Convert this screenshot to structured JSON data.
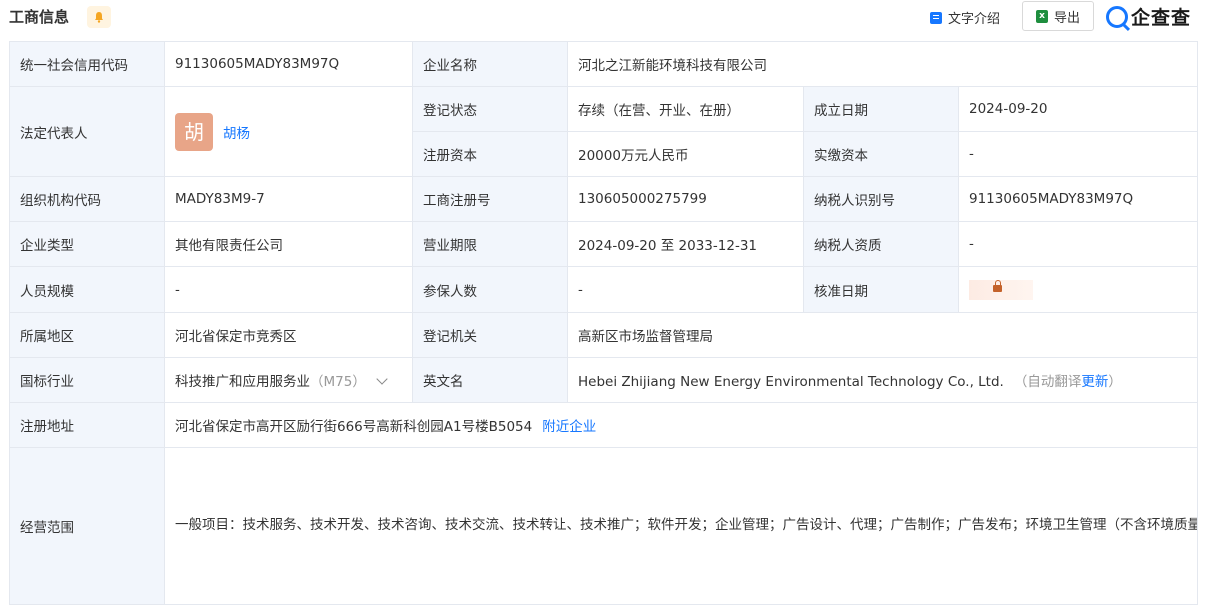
{
  "header": {
    "title": "工商信息",
    "intro_label": "文字介绍",
    "export_label": "导出",
    "logo_text": "企查查"
  },
  "rows": {
    "credit_code": {
      "label": "统一社会信用代码",
      "value": "91130605MADY83M97Q"
    },
    "company_name": {
      "label": "企业名称",
      "value": "河北之江新能环境科技有限公司"
    },
    "legal_rep": {
      "label": "法定代表人",
      "avatar": "胡",
      "name": "胡杨"
    },
    "reg_status": {
      "label": "登记状态",
      "value": "存续（在营、开业、在册）"
    },
    "founded": {
      "label": "成立日期",
      "value": "2024-09-20"
    },
    "reg_capital": {
      "label": "注册资本",
      "value": "20000万元人民币"
    },
    "paid_capital": {
      "label": "实缴资本",
      "value": "-"
    },
    "org_code": {
      "label": "组织机构代码",
      "value": "MADY83M9-7"
    },
    "biz_reg_no": {
      "label": "工商注册号",
      "value": "130605000275799"
    },
    "taxpayer_id": {
      "label": "纳税人识别号",
      "value": "91130605MADY83M97Q"
    },
    "company_type": {
      "label": "企业类型",
      "value": "其他有限责任公司"
    },
    "biz_term": {
      "label": "营业期限",
      "value": "2024-09-20 至 2033-12-31"
    },
    "taxpayer_qual": {
      "label": "纳税人资质",
      "value": "-"
    },
    "staff_size": {
      "label": "人员规模",
      "value": "-"
    },
    "insured": {
      "label": "参保人数",
      "value": "-"
    },
    "approval_date": {
      "label": "核准日期"
    },
    "region": {
      "label": "所属地区",
      "value": "河北省保定市竞秀区"
    },
    "reg_authority": {
      "label": "登记机关",
      "value": "高新区市场监督管理局"
    },
    "industry": {
      "label": "国标行业",
      "value": "科技推广和应用服务业",
      "code": "（M75）"
    },
    "english_name": {
      "label": "英文名",
      "value": "Hebei Zhijiang New Energy Environmental Technology Co., Ltd.",
      "auto_note": "（自动翻译",
      "update_link": "更新",
      "close_paren": "）"
    },
    "reg_address": {
      "label": "注册地址",
      "value": "河北省保定市高开区励行街666号高新科创园A1号楼B5054",
      "nearby_link": "附近企业"
    },
    "scope": {
      "label": "经营范围",
      "value": "一般项目：技术服务、技术开发、技术咨询、技术交流、技术转让、技术推广；软件开发；企业管理；广告设计、代理；广告制作；广告发布；环境卫生管理（不含环境质量监测，污染源检查，城市生活垃圾、建筑垃圾、餐厨垃圾的处置服务）；物业管理；建筑物清洁服务；城市绿化管理；城市公园管理；水污染治理；市政设施管理；园林绿化工程施工；土石方工程施工；租赁服务（不含许可类租赁服务）；特种设备出租；花卉绿植租借与代管理；特种设备销售；机械设备销售；汽车销售；汽车零配件批发；汽车装饰用品销售；礼品花卉销售；金属工具销售；环境保护专用设备销售。（除依法须经批准的项目外，凭营业执照依法自主开展经营活动）许可项目：城市生活垃圾经营性服务；建设工程设计。（依法须经批准的项目，经相关部门批准后方可开展经营活动，具体经营项目以相关部门批准文件或许可证件为准）"
    }
  },
  "colors": {
    "accent": "#1677ff",
    "label_bg": "#f2f6fc",
    "border": "#e4e8ef",
    "avatar_bg": "#e8a588"
  }
}
